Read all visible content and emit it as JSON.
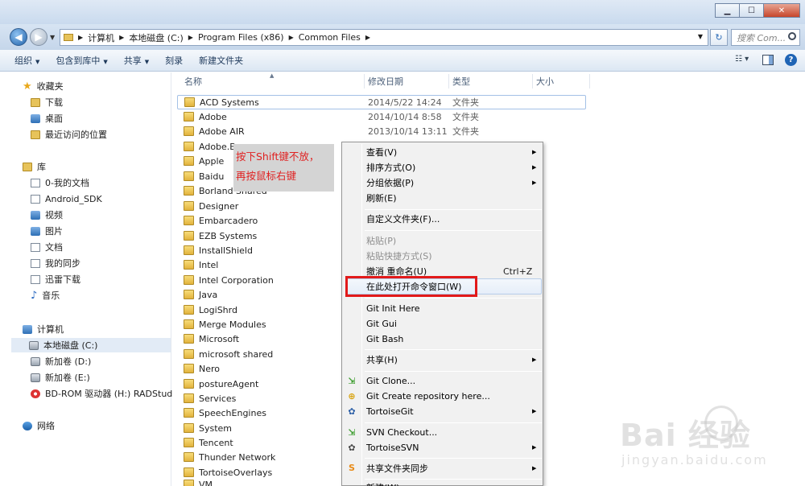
{
  "window": {
    "min": "▁",
    "max": "☐",
    "close": "✕"
  },
  "address": {
    "crumbs": [
      "计算机",
      "本地磁盘 (C:)",
      "Program Files (x86)",
      "Common Files"
    ],
    "search_placeholder": "搜索 Com..."
  },
  "toolbar": {
    "organize": "组织",
    "include": "包含到库中",
    "share": "共享",
    "burn": "刻录",
    "new_folder": "新建文件夹"
  },
  "nav": {
    "favorites": "收藏夹",
    "favorites_items": [
      "下载",
      "桌面",
      "最近访问的位置"
    ],
    "libraries": "库",
    "library_items": [
      "0-我的文档",
      "Android_SDK",
      "视频",
      "图片",
      "文档",
      "我的同步",
      "迅雷下载",
      "音乐"
    ],
    "computer": "计算机",
    "computer_items": [
      "本地磁盘 (C:)",
      "新加卷 (D:)",
      "新加卷 (E:)",
      "BD-ROM 驱动器 (H:) RADStudio"
    ],
    "network": "网络"
  },
  "columns": {
    "name": "名称",
    "date": "修改日期",
    "type": "类型",
    "size": "大小"
  },
  "files": [
    {
      "name": "ACD Systems",
      "date": "2014/5/22 14:24",
      "type": "文件夹"
    },
    {
      "name": "Adobe",
      "date": "2014/10/14 8:58",
      "type": "文件夹"
    },
    {
      "name": "Adobe AIR",
      "date": "2013/10/14 13:11",
      "type": "文件夹"
    },
    {
      "name": "Adobe.Ba",
      "date": "",
      "type": ""
    },
    {
      "name": "Apple",
      "date": "",
      "type": ""
    },
    {
      "name": "Baidu",
      "date": "",
      "type": ""
    },
    {
      "name": "Borland Shared",
      "date": "",
      "type": ""
    },
    {
      "name": "Designer",
      "date": "",
      "type": ""
    },
    {
      "name": "Embarcadero",
      "date": "",
      "type": ""
    },
    {
      "name": "EZB Systems",
      "date": "",
      "type": ""
    },
    {
      "name": "InstallShield",
      "date": "",
      "type": ""
    },
    {
      "name": "Intel",
      "date": "",
      "type": ""
    },
    {
      "name": "Intel Corporation",
      "date": "",
      "type": ""
    },
    {
      "name": "Java",
      "date": "",
      "type": ""
    },
    {
      "name": "LogiShrd",
      "date": "",
      "type": ""
    },
    {
      "name": "Merge Modules",
      "date": "",
      "type": ""
    },
    {
      "name": "Microsoft",
      "date": "",
      "type": ""
    },
    {
      "name": "microsoft shared",
      "date": "",
      "type": ""
    },
    {
      "name": "Nero",
      "date": "",
      "type": ""
    },
    {
      "name": "postureAgent",
      "date": "",
      "type": ""
    },
    {
      "name": "Services",
      "date": "",
      "type": ""
    },
    {
      "name": "SpeechEngines",
      "date": "",
      "type": ""
    },
    {
      "name": "System",
      "date": "",
      "type": ""
    },
    {
      "name": "Tencent",
      "date": "",
      "type": ""
    },
    {
      "name": "Thunder Network",
      "date": "",
      "type": ""
    },
    {
      "name": "TortoiseOverlays",
      "date": "",
      "type": ""
    },
    {
      "name": "VM",
      "date": "",
      "type": ""
    }
  ],
  "annotation": {
    "line1": "按下Shift键不放，",
    "line2": "再按鼠标右键"
  },
  "menu": {
    "view": "查看(V)",
    "sort": "排序方式(O)",
    "group": "分组依据(P)",
    "refresh": "刷新(E)",
    "customize": "自定义文件夹(F)...",
    "paste": "粘贴(P)",
    "paste_shortcut": "粘贴快捷方式(S)",
    "undo": "撤消 重命名(U)",
    "undo_shortcut": "Ctrl+Z",
    "open_cmd": "在此处打开命令窗口(W)",
    "git_init": "Git Init Here",
    "git_gui": "Git Gui",
    "git_bash": "Git Bash",
    "share": "共享(H)",
    "git_clone": "Git Clone...",
    "git_create": "Git Create repository here...",
    "tortoisegit": "TortoiseGit",
    "svn_checkout": "SVN Checkout...",
    "tortoisesvn": "TortoiseSVN",
    "share_sync": "共享文件夹同步",
    "new": "新建(W)"
  },
  "watermark": {
    "brand": "Bai  经验",
    "url": "jingyan.baidu.com"
  }
}
